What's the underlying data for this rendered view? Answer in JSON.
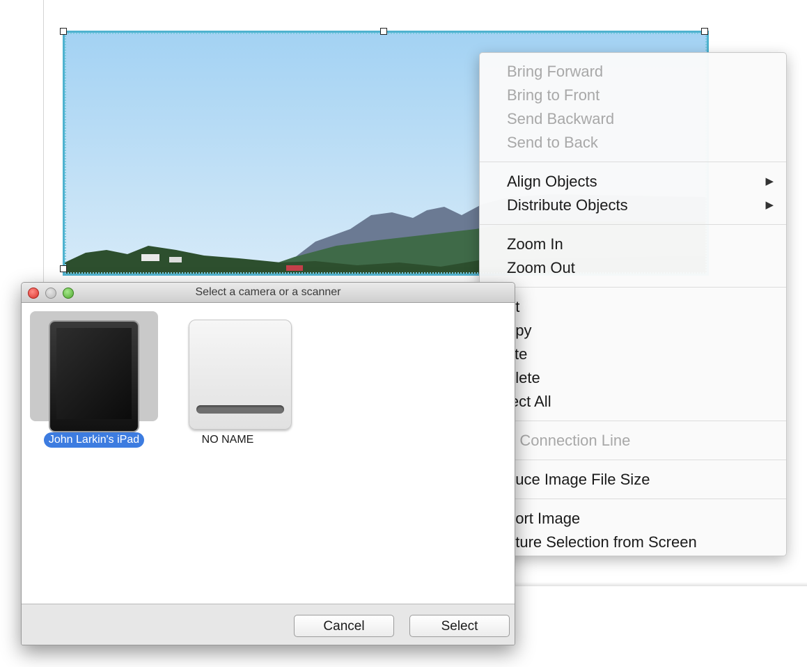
{
  "context_menu": {
    "groups": [
      [
        {
          "label": "Bring Forward",
          "enabled": false
        },
        {
          "label": "Bring to Front",
          "enabled": false
        },
        {
          "label": "Send Backward",
          "enabled": false
        },
        {
          "label": "Send to Back",
          "enabled": false
        }
      ],
      [
        {
          "label": "Align Objects",
          "enabled": true,
          "submenu": true
        },
        {
          "label": "Distribute Objects",
          "enabled": true,
          "submenu": true
        }
      ],
      [
        {
          "label": "Zoom In",
          "enabled": true
        },
        {
          "label": "Zoom Out",
          "enabled": true
        }
      ],
      [
        {
          "label": "ut",
          "enabled": true
        },
        {
          "label": "opy",
          "enabled": true
        },
        {
          "label": "ste",
          "enabled": true
        },
        {
          "label": "elete",
          "enabled": true
        },
        {
          "label": "lect All",
          "enabled": true
        }
      ],
      [
        {
          "label": "d Connection Line",
          "enabled": false
        }
      ],
      [
        {
          "label": "duce Image File Size",
          "enabled": true
        }
      ],
      [
        {
          "label": "port Image",
          "enabled": true
        },
        {
          "label": "pture Selection from Screen",
          "enabled": true
        }
      ]
    ],
    "submenu_arrow": "▶"
  },
  "dialog": {
    "title": "Select a camera or a scanner",
    "devices": [
      {
        "label": "John Larkin's iPad",
        "icon": "ipad-icon",
        "selected": true
      },
      {
        "label": "NO NAME",
        "icon": "external-drive-icon",
        "selected": false
      }
    ],
    "buttons": {
      "cancel": "Cancel",
      "select": "Select"
    }
  },
  "colors": {
    "selection_border": "#4fb2cf",
    "selected_label_bg": "#3d7ce0",
    "sky_top": "#a6d4f2",
    "sky_bottom": "#d2e8f7"
  }
}
